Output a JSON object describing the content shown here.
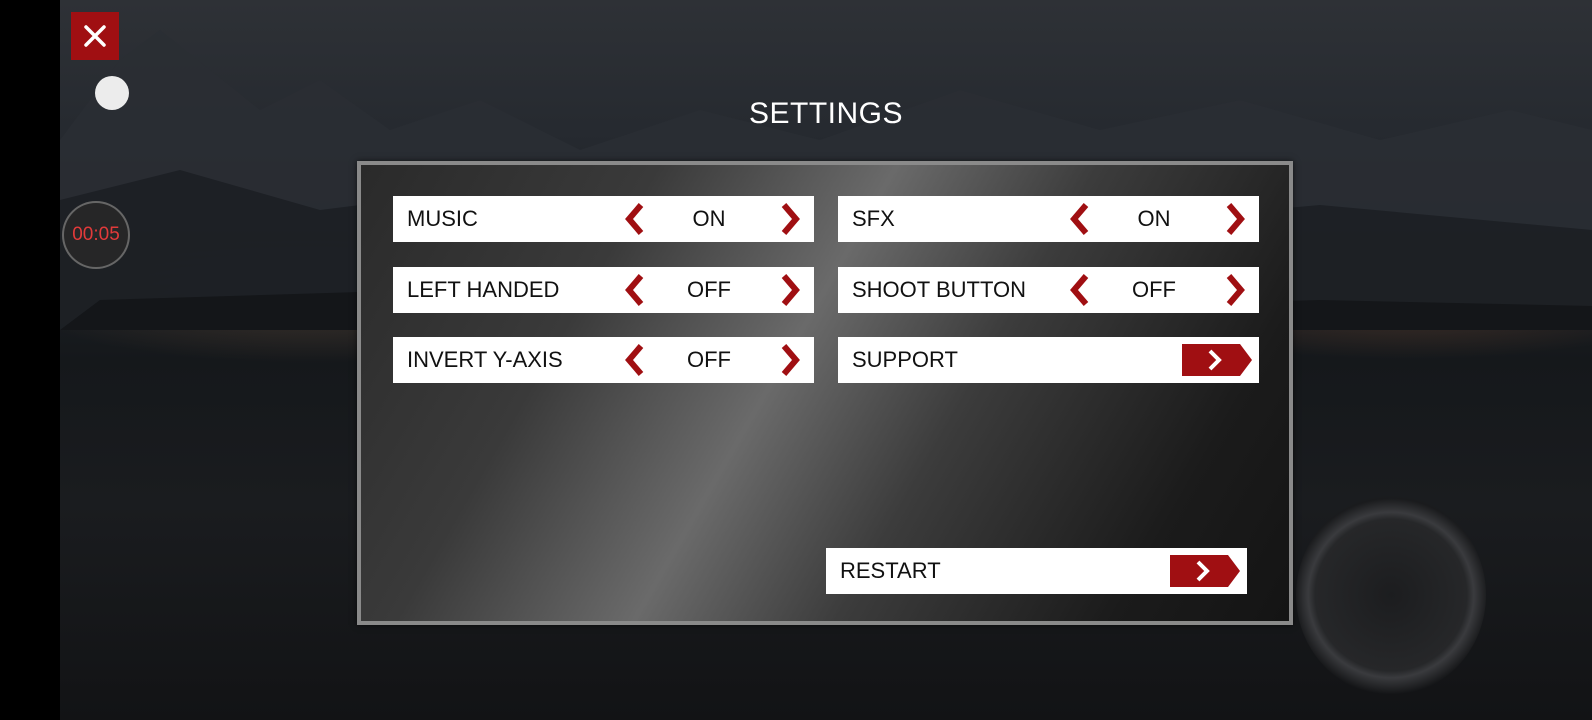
{
  "screen": {
    "title": "SETTINGS"
  },
  "hud": {
    "timer": "00:05",
    "close_icon": "close-icon"
  },
  "settings": {
    "music": {
      "label": "MUSIC",
      "value": "ON"
    },
    "sfx": {
      "label": "SFX",
      "value": "ON"
    },
    "left_handed": {
      "label": "LEFT HANDED",
      "value": "OFF"
    },
    "shoot_button": {
      "label": "SHOOT BUTTON",
      "value": "OFF"
    },
    "invert_y": {
      "label": "INVERT Y-AXIS",
      "value": "OFF"
    },
    "support": {
      "label": "SUPPORT"
    },
    "restart": {
      "label": "RESTART"
    }
  },
  "colors": {
    "accent": "#a00f12",
    "panel_border": "#8a8a8a",
    "row_bg": "#ffffff",
    "timer_text": "#e23a3a"
  }
}
